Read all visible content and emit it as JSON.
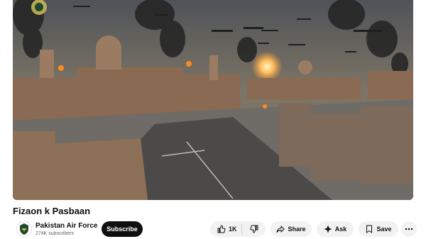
{
  "video": {
    "title": "Fizaon k Pasbaan"
  },
  "channel": {
    "name": "Pakistan Air Force",
    "subscribers": "274K subscribers"
  },
  "actions": {
    "subscribe_label": "Subscribe",
    "like_count": "1K",
    "share_label": "Share",
    "ask_label": "Ask",
    "save_label": "Save"
  },
  "icons": {
    "like": "thumbs-up-icon",
    "dislike": "thumbs-down-icon",
    "share": "share-arrow-icon",
    "ask": "sparkle-icon",
    "save": "bookmark-icon",
    "more": "more-horizontal-icon"
  },
  "colors": {
    "subscribe_bg": "#0f0f0f",
    "pill_bg": "#f2f2f2"
  }
}
